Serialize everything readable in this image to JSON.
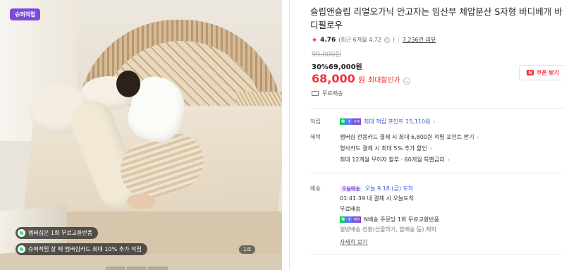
{
  "gallery": {
    "super_badge": "슈퍼적립",
    "promo_1": "멤버십은 1회 무료교환반품",
    "promo_2": "슈퍼적립 살 때 멤버십카드 최대 10% 추가 적립",
    "pager": "1/5"
  },
  "product": {
    "title": "슬립앤슬립 리얼오가닉 안고자는 임산부 체압분산 S자형 바디베개 바디필로우",
    "rating": {
      "score": "4.76",
      "recent": "(최근 6개월 4.72",
      "reviews": "7,236건 리뷰"
    },
    "original_price": "99,000원",
    "discount_line": "30%69,000원",
    "final_price": "68,000",
    "final_unit": "원",
    "max_discount_label": "최대할인가",
    "coupon_label": "쿠폰 받기",
    "free_shipping": "무료배송"
  },
  "benefits": {
    "points_label": "적립",
    "points_value": "최대 적립 포인트 15,110원",
    "perks_label": "혜택",
    "perks": [
      "멤버십 전용카드 결제 시 최대 6,800원 적립 포인트 받기",
      "행사카드 결제 시 최대 5% 추가 할인",
      "최대 12개월 무이자 할부 · 60개월 특별금리"
    ]
  },
  "delivery": {
    "label": "배송",
    "today_badge": "오늘배송",
    "arrival": "오늘 9.18.(금) 도착",
    "countdown": "01:41:39  내 결제 시 오늘도착",
    "fee": "무료배송",
    "return_policy": "N배송 주문당 1회 무료교환반품",
    "exclusion": "일반배송 전환(선물하기, 합배송 등) 제외",
    "details_link": "자세히 보기"
  },
  "colors": {
    "accent_red": "#f0333a",
    "naver_green": "#03c75a",
    "membership_purple": "#7c4bd8"
  }
}
